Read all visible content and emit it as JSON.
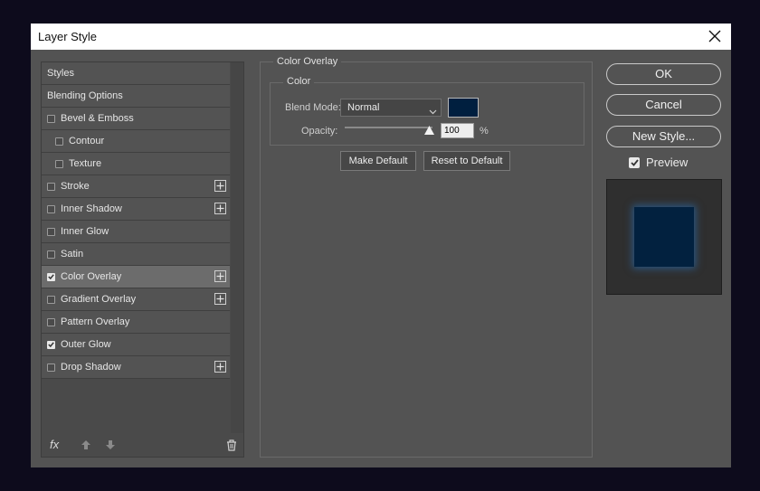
{
  "dialog": {
    "title": "Layer Style"
  },
  "styles_list": [
    {
      "label": "Styles",
      "checkbox": false,
      "checked": false,
      "plus": false,
      "indent": 0,
      "selected": false
    },
    {
      "label": "Blending Options",
      "checkbox": false,
      "checked": false,
      "plus": false,
      "indent": 0,
      "selected": false
    },
    {
      "label": "Bevel & Emboss",
      "checkbox": true,
      "checked": false,
      "plus": false,
      "indent": 0,
      "selected": false
    },
    {
      "label": "Contour",
      "checkbox": true,
      "checked": false,
      "plus": false,
      "indent": 1,
      "selected": false
    },
    {
      "label": "Texture",
      "checkbox": true,
      "checked": false,
      "plus": false,
      "indent": 1,
      "selected": false
    },
    {
      "label": "Stroke",
      "checkbox": true,
      "checked": false,
      "plus": true,
      "indent": 0,
      "selected": false
    },
    {
      "label": "Inner Shadow",
      "checkbox": true,
      "checked": false,
      "plus": true,
      "indent": 0,
      "selected": false
    },
    {
      "label": "Inner Glow",
      "checkbox": true,
      "checked": false,
      "plus": false,
      "indent": 0,
      "selected": false
    },
    {
      "label": "Satin",
      "checkbox": true,
      "checked": false,
      "plus": false,
      "indent": 0,
      "selected": false
    },
    {
      "label": "Color Overlay",
      "checkbox": true,
      "checked": true,
      "plus": true,
      "indent": 0,
      "selected": true
    },
    {
      "label": "Gradient Overlay",
      "checkbox": true,
      "checked": false,
      "plus": true,
      "indent": 0,
      "selected": false
    },
    {
      "label": "Pattern Overlay",
      "checkbox": true,
      "checked": false,
      "plus": false,
      "indent": 0,
      "selected": false
    },
    {
      "label": "Outer Glow",
      "checkbox": true,
      "checked": true,
      "plus": false,
      "indent": 0,
      "selected": false
    },
    {
      "label": "Drop Shadow",
      "checkbox": true,
      "checked": false,
      "plus": true,
      "indent": 0,
      "selected": false
    }
  ],
  "footer": {
    "fx_label": "fx"
  },
  "color_overlay": {
    "group_title": "Color Overlay",
    "subgroup_title": "Color",
    "blend_mode_label": "Blend Mode:",
    "blend_mode_value": "Normal",
    "color_swatch": "#001f3f",
    "opacity_label": "Opacity:",
    "opacity_value": "100",
    "opacity_unit": "%",
    "make_default_label": "Make Default",
    "reset_default_label": "Reset to Default"
  },
  "actions": {
    "ok_label": "OK",
    "cancel_label": "Cancel",
    "new_style_label": "New Style...",
    "preview_label": "Preview",
    "preview_checked": true
  },
  "colors": {
    "dialog_bg": "#535353",
    "selected_bg": "#6c6c6c",
    "overlay_color": "#001f3f",
    "backdrop": "#0d0b1c"
  }
}
